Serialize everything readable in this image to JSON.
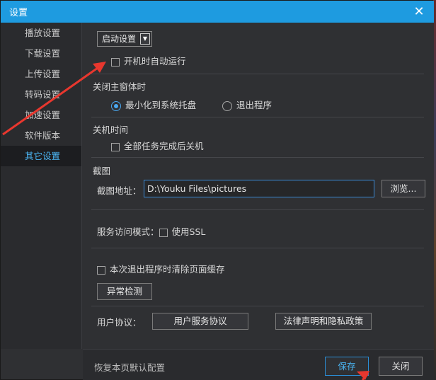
{
  "window": {
    "title": "设置",
    "close_glyph": "✕"
  },
  "sidebar": {
    "items": [
      {
        "label": "播放设置"
      },
      {
        "label": "下载设置"
      },
      {
        "label": "上传设置"
      },
      {
        "label": "转码设置"
      },
      {
        "label": "加速设置"
      },
      {
        "label": "软件版本"
      },
      {
        "label": "其它设置"
      }
    ],
    "active": "其它设置"
  },
  "startup": {
    "dropdown_value": "启动设置",
    "autorun_label": "开机时自动运行",
    "autorun_checked": false
  },
  "close_main": {
    "title": "关闭主窗体时",
    "options": [
      {
        "label": "最小化到系统托盘",
        "checked": true
      },
      {
        "label": "退出程序",
        "checked": false
      }
    ]
  },
  "shutdown": {
    "title": "关机时间",
    "option_label": "全部任务完成后关机",
    "checked": false
  },
  "screenshot": {
    "title": "截图",
    "path_label": "截图地址：",
    "path_value": "D:\\Youku Files\\pictures",
    "browse_label": "浏览..."
  },
  "service": {
    "label": "服务访问模式：",
    "ssl_label": "使用SSL",
    "ssl_checked": false
  },
  "cache": {
    "clear_label": "本次退出程序时清除页面缓存",
    "checked": false
  },
  "diagnostics": {
    "label": "异常检测"
  },
  "agreement": {
    "label": "用户协议：",
    "service_agreement": "用户服务协议",
    "legal_privacy": "法律声明和隐私政策"
  },
  "footer": {
    "reset_label": "恢复本页默认配置",
    "save_label": "保存",
    "close_label": "关闭"
  },
  "colors": {
    "accent": "#1e9be0",
    "annotation_arrow": "#e8372e"
  }
}
